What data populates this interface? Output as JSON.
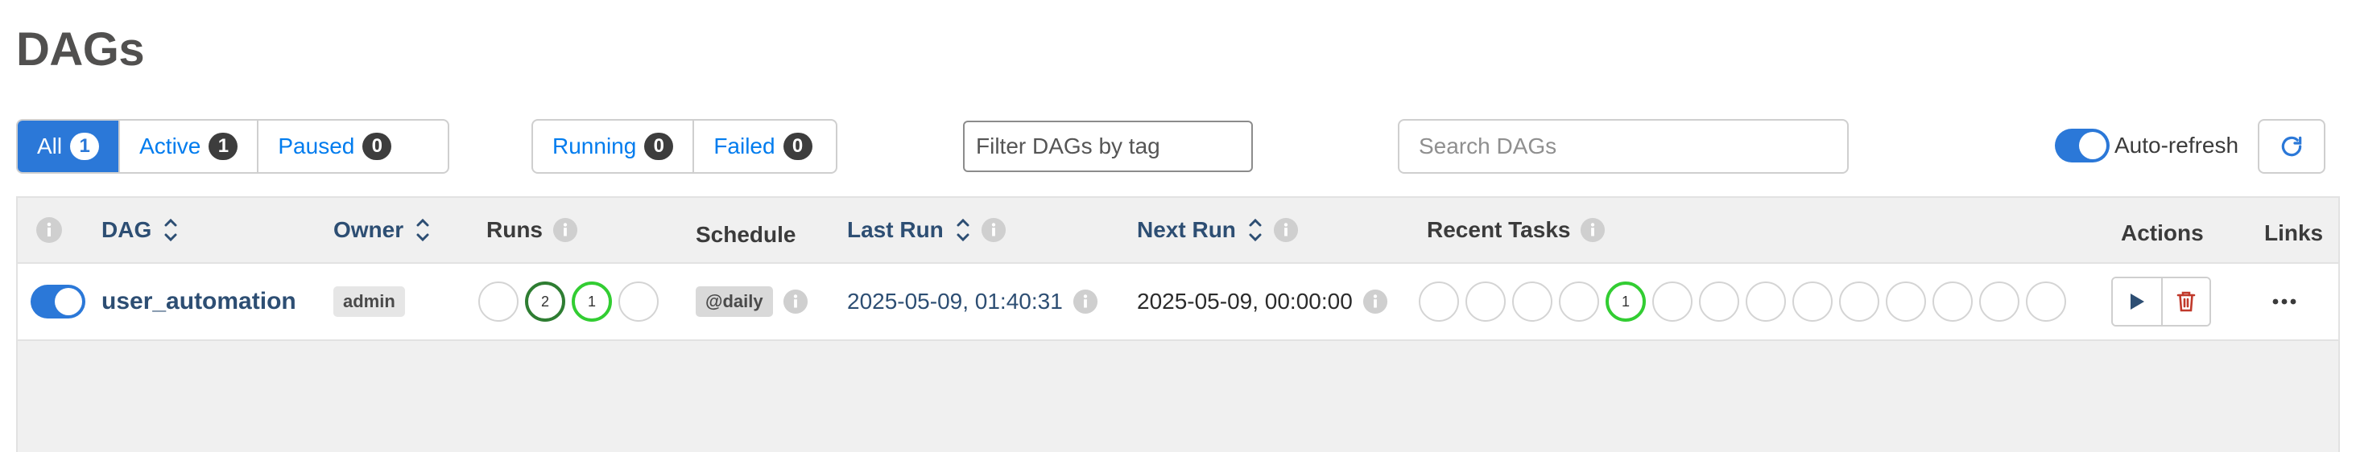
{
  "page": {
    "title": "DAGs"
  },
  "status_filters": [
    {
      "label": "All",
      "count": "1",
      "active": true
    },
    {
      "label": "Active",
      "count": "1",
      "active": false
    },
    {
      "label": "Paused",
      "count": "0",
      "active": false
    }
  ],
  "run_filters": [
    {
      "label": "Running",
      "count": "0"
    },
    {
      "label": "Failed",
      "count": "0"
    }
  ],
  "tag_filter": {
    "placeholder": "Filter DAGs by tag"
  },
  "search": {
    "placeholder": "Search DAGs"
  },
  "auto_refresh": {
    "label": "Auto-refresh",
    "enabled": true
  },
  "table": {
    "columns": {
      "dag": "DAG",
      "owner": "Owner",
      "runs": "Runs",
      "schedule": "Schedule",
      "last_run": "Last Run",
      "next_run": "Next Run",
      "recent_tasks": "Recent Tasks",
      "actions": "Actions",
      "links": "Links"
    },
    "rows": [
      {
        "enabled": true,
        "dag_id": "user_automation",
        "owner": "admin",
        "runs": [
          "",
          "2",
          "1",
          ""
        ],
        "schedule": "@daily",
        "last_run": "2025-05-09, 01:40:31",
        "next_run": "2025-05-09, 00:00:00",
        "recent_tasks": [
          "",
          "",
          "",
          "",
          "1",
          "",
          "",
          "",
          "",
          "",
          "",
          "",
          "",
          ""
        ],
        "links": "..."
      }
    ]
  },
  "colors": {
    "accent": "#2b78d8",
    "link": "#2d4e73",
    "success": "#2e7d32",
    "running": "#32cd32",
    "delete": "#c0392b"
  }
}
